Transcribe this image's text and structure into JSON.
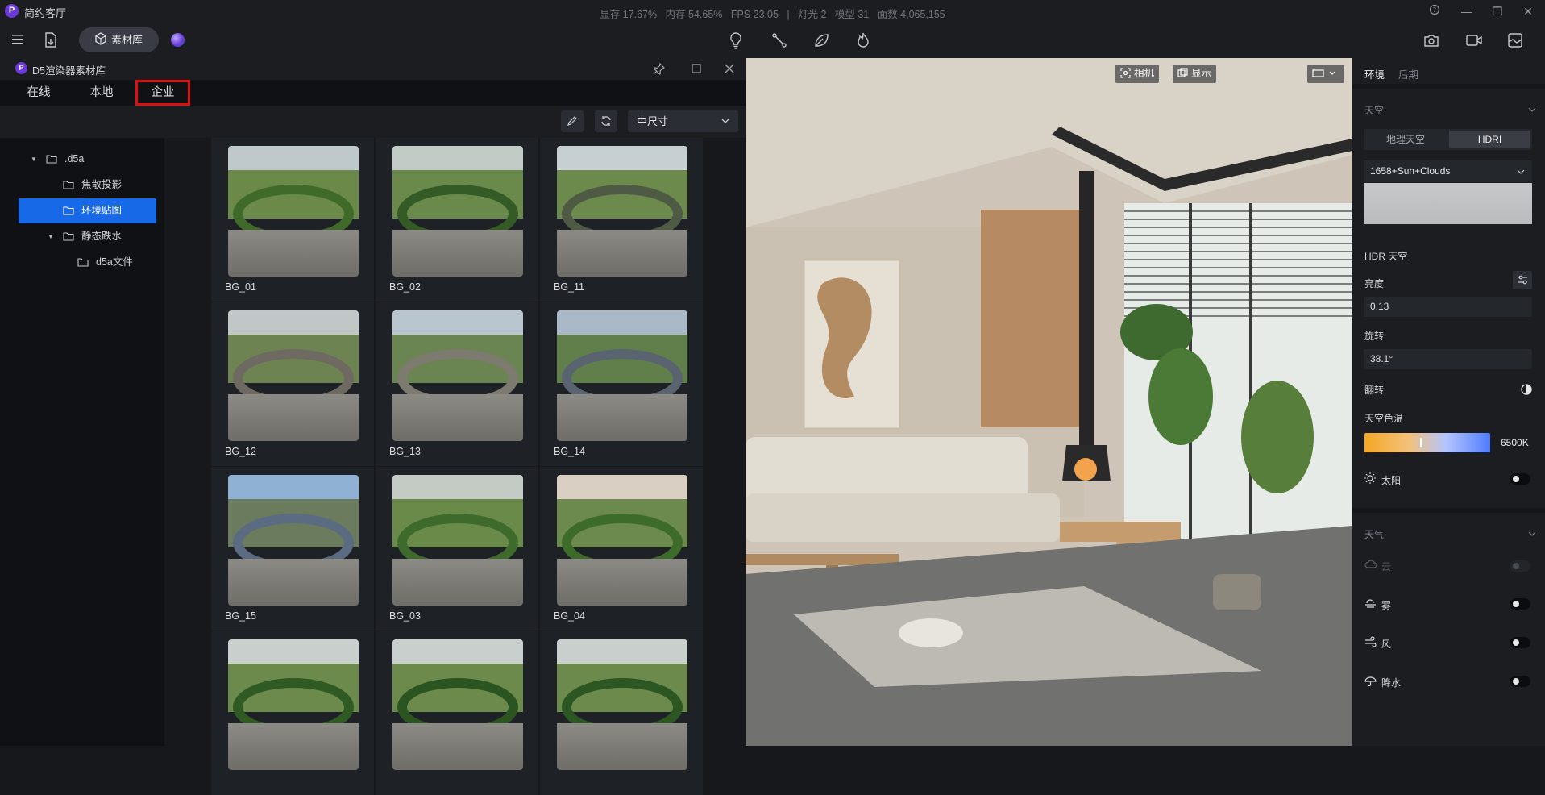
{
  "app": {
    "logo_letter": "P",
    "title": "简约客厅"
  },
  "stats": {
    "vram": "显存 17.67%",
    "ram": "内存 54.65%",
    "fps": "FPS 23.05",
    "sep": "|",
    "lights": "灯光 2",
    "models": "模型 31",
    "faces": "面数 4,065,155"
  },
  "window_controls": {
    "help": "?",
    "minimize": "—",
    "restore": "❐",
    "close": "✕"
  },
  "toolbar": {
    "library_label": "素材库"
  },
  "asset_library": {
    "title": "D5渲染器素材库",
    "tabs": [
      "在线",
      "本地",
      "企业"
    ],
    "active_tab": "企业",
    "size_select": "中尺寸",
    "tree": [
      {
        "label": ".d5a",
        "level": 0,
        "expanded": true
      },
      {
        "label": "焦散投影",
        "level": 1
      },
      {
        "label": "环境贴图",
        "level": 1,
        "selected": true
      },
      {
        "label": "静态跌水",
        "level": 1,
        "expanded": true
      },
      {
        "label": "d5a文件",
        "level": 2
      }
    ],
    "items": [
      {
        "name": "BG_01",
        "sky": "#bfc9cc",
        "grass": "#6b8a4a",
        "ring": "#3f6a2a"
      },
      {
        "name": "BG_02",
        "sky": "#c3cbc6",
        "grass": "#6a8a4b",
        "ring": "#345a25"
      },
      {
        "name": "BG_11",
        "sky": "#c7cfd2",
        "grass": "#6c8a4c",
        "ring": "#4e5a44"
      },
      {
        "name": "BG_12",
        "sky": "#c1c6c7",
        "grass": "#6e8352",
        "ring": "#6e6a62"
      },
      {
        "name": "BG_13",
        "sky": "#b9c6cf",
        "grass": "#6a8452",
        "ring": "#7d7a6f"
      },
      {
        "name": "BG_14",
        "sky": "#a9b9c7",
        "grass": "#617f4a",
        "ring": "#5a6470"
      },
      {
        "name": "BG_15",
        "sky": "#8fb1d4",
        "grass": "#6a7b5e",
        "ring": "#5b6b82"
      },
      {
        "name": "BG_03",
        "sky": "#c3cbc4",
        "grass": "#6a8a4a",
        "ring": "#3e6a2c"
      },
      {
        "name": "BG_04",
        "sky": "#d9cfc2",
        "grass": "#6c8a4e",
        "ring": "#3d6b2a"
      },
      {
        "name": "",
        "sky": "#c9cfcd",
        "grass": "#6b8a4c",
        "ring": "#2f5a23"
      },
      {
        "name": "",
        "sky": "#c9cfcd",
        "grass": "#6c8a4c",
        "ring": "#2b5520"
      },
      {
        "name": "",
        "sky": "#c9cfcd",
        "grass": "#6c8a4c",
        "ring": "#2d5722"
      }
    ]
  },
  "viewport": {
    "camera_label": "相机",
    "display_label": "显示"
  },
  "right_panel": {
    "tabs": [
      "环境",
      "后期"
    ],
    "sky_section": "天空",
    "sky_modes": [
      "地理天空",
      "HDRI"
    ],
    "hdri_value": "1658+Sun+Clouds",
    "hdr_sky_label": "HDR 天空",
    "brightness_label": "亮度",
    "brightness_value": "0.13",
    "rotation_label": "旋转",
    "rotation_value": "38.1°",
    "flip_label": "翻转",
    "color_temp_label": "天空色温",
    "color_temp_value": "6500K",
    "sun_label": "太阳",
    "weather_section": "天气",
    "cloud_label": "云",
    "fog_label": "雾",
    "wind_label": "风",
    "rain_label": "降水"
  },
  "colors": {
    "accent": "#1769e8",
    "highlight": "#e01010"
  }
}
